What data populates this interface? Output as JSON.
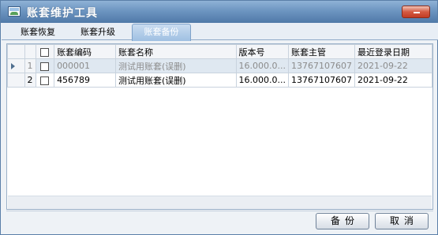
{
  "window": {
    "title": "账套维护工具"
  },
  "tabs": [
    {
      "label": "账套恢复"
    },
    {
      "label": "账套升级"
    },
    {
      "label": "账套备份"
    }
  ],
  "grid": {
    "columns": [
      "账套编码",
      "账套名称",
      "版本号",
      "账套主管",
      "最近登录日期"
    ],
    "rows": [
      {
        "num": "1",
        "code": "000001",
        "name": "测试用账套(误删)",
        "version": "16.000.0...",
        "manager": "13767107607",
        "last_login": "2021-09-22"
      },
      {
        "num": "2",
        "code": "456789",
        "name": "测试用账套(误删)",
        "version": "16.000.0...",
        "manager": "13767107607",
        "last_login": "2021-09-22"
      }
    ]
  },
  "buttons": {
    "backup": "备份",
    "cancel": "取消"
  }
}
